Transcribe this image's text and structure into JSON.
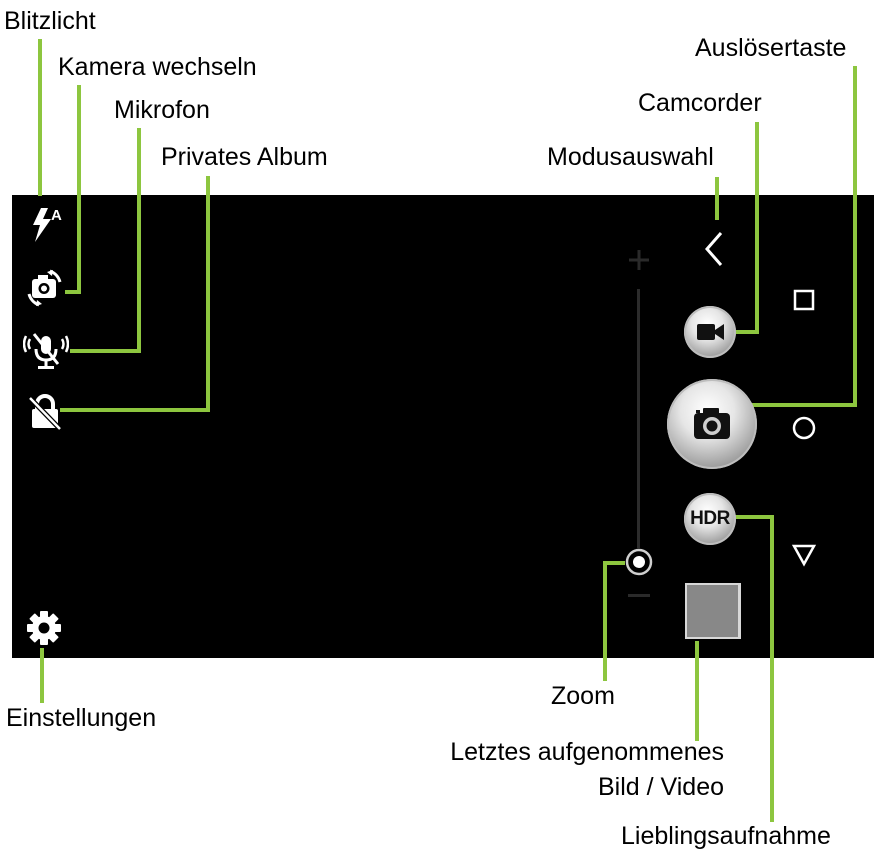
{
  "labels": {
    "blitzlicht": "Blitzlicht",
    "kamera_wechseln": "Kamera wechseln",
    "mikrofon": "Mikrofon",
    "privates_album": "Privates Album",
    "modusauswahl": "Modusauswahl",
    "camcorder": "Camcorder",
    "ausloesertaste": "Auslösertaste",
    "einstellungen": "Einstellungen",
    "zoom": "Zoom",
    "letztes_line1": "Letztes aufgenommenes",
    "letztes_line2": "Bild / Video",
    "lieblingsaufnahme": "Lieblingsaufnahme"
  },
  "buttons": {
    "hdr": "HDR",
    "flash_mode": "A"
  },
  "icons": {
    "flash": "flash-auto-icon",
    "switch_camera": "switch-camera-icon",
    "microphone": "microphone-muted-icon",
    "private_album": "lock-off-icon",
    "settings": "gear-icon",
    "mode_select": "chevron-left-icon",
    "recent_apps": "square-icon",
    "home": "circle-icon",
    "back": "triangle-down-icon",
    "camcorder": "video-camera-icon",
    "shutter": "camera-icon"
  },
  "colors": {
    "leader_line": "#8dc63f",
    "screen": "#000000"
  }
}
